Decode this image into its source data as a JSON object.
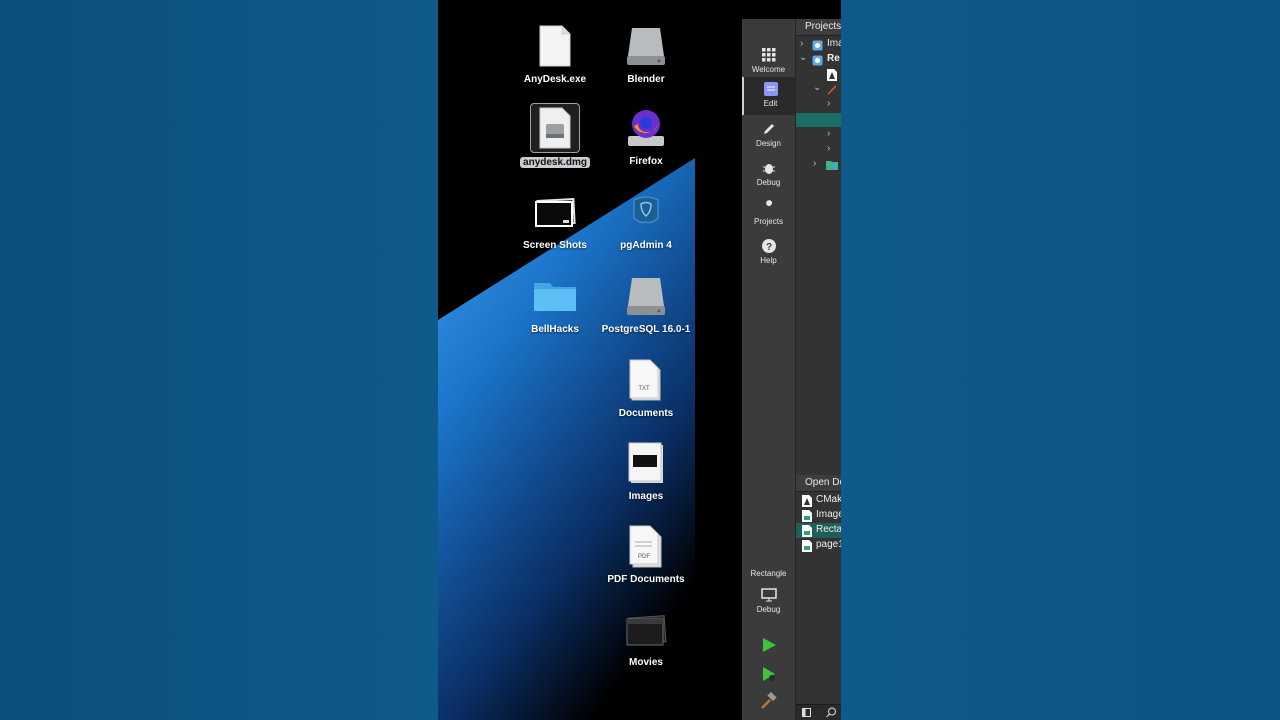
{
  "desktop": {
    "icons": [
      {
        "label": "AnyDesk.exe",
        "icon": "blank-document-icon"
      },
      {
        "label": "Blender",
        "icon": "disk-drive-icon"
      },
      {
        "label": "anydesk.dmg",
        "icon": "dmg-file-icon",
        "selected": true
      },
      {
        "label": "Firefox",
        "icon": "firefox-icon"
      },
      {
        "label": "Screen Shots",
        "icon": "screenshots-stack-icon"
      },
      {
        "label": "pgAdmin 4",
        "icon": "pgadmin-elephant-icon"
      },
      {
        "label": "BellHacks",
        "icon": "folder-icon"
      },
      {
        "label": "PostgreSQL 16.0-1",
        "icon": "disk-drive-icon"
      },
      {
        "label": "Documents",
        "icon": "txt-stack-icon"
      },
      {
        "label": "Images",
        "icon": "images-stack-icon"
      },
      {
        "label": "PDF Documents",
        "icon": "pdf-stack-icon"
      },
      {
        "label": "Movies",
        "icon": "movies-stack-icon"
      }
    ]
  },
  "qt": {
    "modes": [
      {
        "label": "Welcome",
        "icon": "grid-icon"
      },
      {
        "label": "Edit",
        "icon": "edit-document-icon",
        "active": true
      },
      {
        "label": "Design",
        "icon": "pencil-icon"
      },
      {
        "label": "Debug",
        "icon": "bug-icon"
      },
      {
        "label": "Projects",
        "icon": "wrench-icon"
      },
      {
        "label": "Help",
        "icon": "help-circle-icon"
      }
    ],
    "kit": {
      "project": "Rectangle",
      "build": "Debug"
    },
    "projects_header": "Projects",
    "tree": [
      {
        "text": "Ima"
      },
      {
        "text": "Re"
      }
    ],
    "open_documents_header": "Open Do",
    "open_documents": [
      {
        "text": "CMak"
      },
      {
        "text": "Image"
      },
      {
        "text": "Recta",
        "selected": true
      },
      {
        "text": "page1"
      }
    ]
  }
}
